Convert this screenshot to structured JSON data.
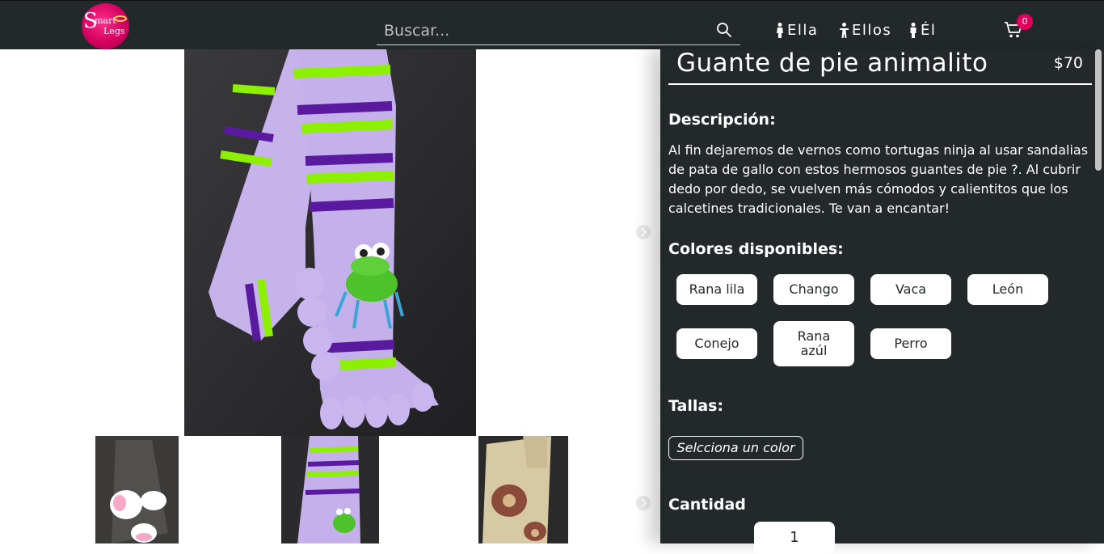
{
  "header": {
    "logo_text": [
      "S",
      "mart",
      "Legs"
    ],
    "search_placeholder": "Buscar...",
    "nav": [
      {
        "label": "Ella",
        "icon": "female-icon"
      },
      {
        "label": "Ellos",
        "icon": "people-icon"
      },
      {
        "label": "Él",
        "icon": "male-icon"
      }
    ],
    "cart_count": "0"
  },
  "product": {
    "title": "Guante de pie animalito",
    "price": "$70",
    "description_heading": "Descripción:",
    "description": "Al fin dejaremos de vernos como tortugas ninja al usar sandalias de pata de gallo con estos hermosos guantes de pie ?. Al cubrir dedo por dedo, se vuelven más cómodos y calientitos que los calcetines tradicionales. Te van a encantar!",
    "colors_heading": "Colores disponibles:",
    "colors": [
      "Rana lila",
      "Chango",
      "Vaca",
      "León",
      "Conejo",
      "Rana azúl",
      "Perro"
    ],
    "sizes_heading": "Tallas:",
    "sizes_placeholder": "Selcciona un color",
    "quantity_heading": "Cantidad",
    "quantity": "1"
  },
  "colors": {
    "panel_bg": "#23282b",
    "accent": "#e0005b"
  }
}
